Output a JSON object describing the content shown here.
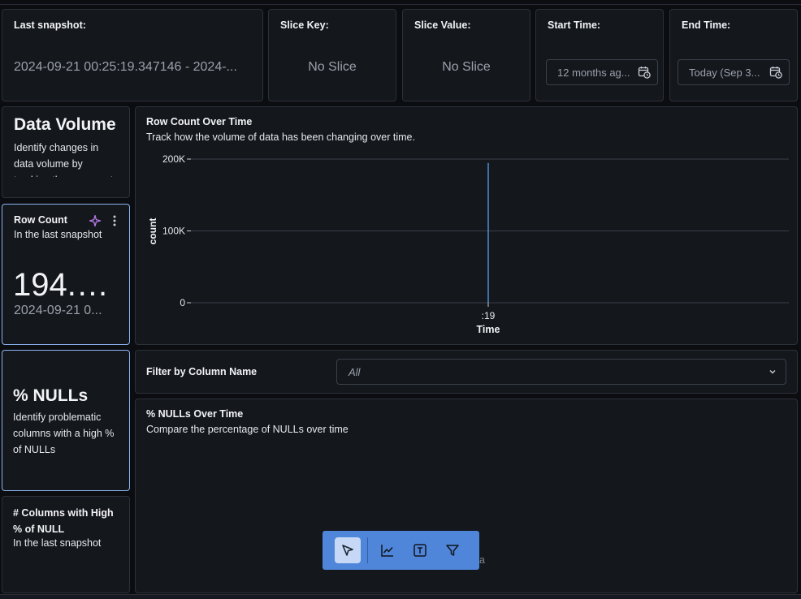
{
  "header": {
    "last_snapshot_label": "Last snapshot:",
    "last_snapshot_value": "2024-09-21 00:25:19.347146 - 2024-...",
    "slice_key_label": "Slice Key:",
    "slice_key_value": "No Slice",
    "slice_value_label": "Slice Value:",
    "slice_value_value": "No Slice",
    "start_time_label": "Start Time:",
    "start_time_value": "12 months ag...",
    "end_time_label": "End Time:",
    "end_time_value": "Today (Sep 3..."
  },
  "data_volume": {
    "title": "Data Volume",
    "description": "Identify changes in data volume by tracking the row count of the table"
  },
  "row_count": {
    "title": "Row Count",
    "subtitle": "In the last snapshot",
    "value": "194.7...",
    "timestamp": "2024-09-21 0..."
  },
  "row_count_chart": {
    "title": "Row Count Over Time",
    "subtitle": "Track how the volume of data has been changing over time."
  },
  "chart_data": {
    "type": "bar",
    "categories": [
      ":19"
    ],
    "values": [
      194700
    ],
    "title": "Row Count Over Time",
    "xlabel": "Time",
    "ylabel": "count",
    "ylim": [
      0,
      200000
    ],
    "yticks": [
      "200K",
      "100K",
      "0"
    ],
    "grid": true
  },
  "filter": {
    "label": "Filter by Column Name",
    "value": "All"
  },
  "nulls": {
    "title": "% NULLs",
    "description": "Identify problematic columns with a high % of NULLs"
  },
  "nulls_chart": {
    "title": "% NULLs Over Time",
    "subtitle": "Compare the percentage of NULLs over time"
  },
  "high_null_cols": {
    "title": "# Columns with High % of NULL",
    "subtitle": "In the last snapshot"
  },
  "toolbar": {
    "tools": [
      "pointer-icon",
      "line-chart-icon",
      "text-icon",
      "filter-icon"
    ],
    "accent": "#4f86d9"
  },
  "stray_text": "a"
}
